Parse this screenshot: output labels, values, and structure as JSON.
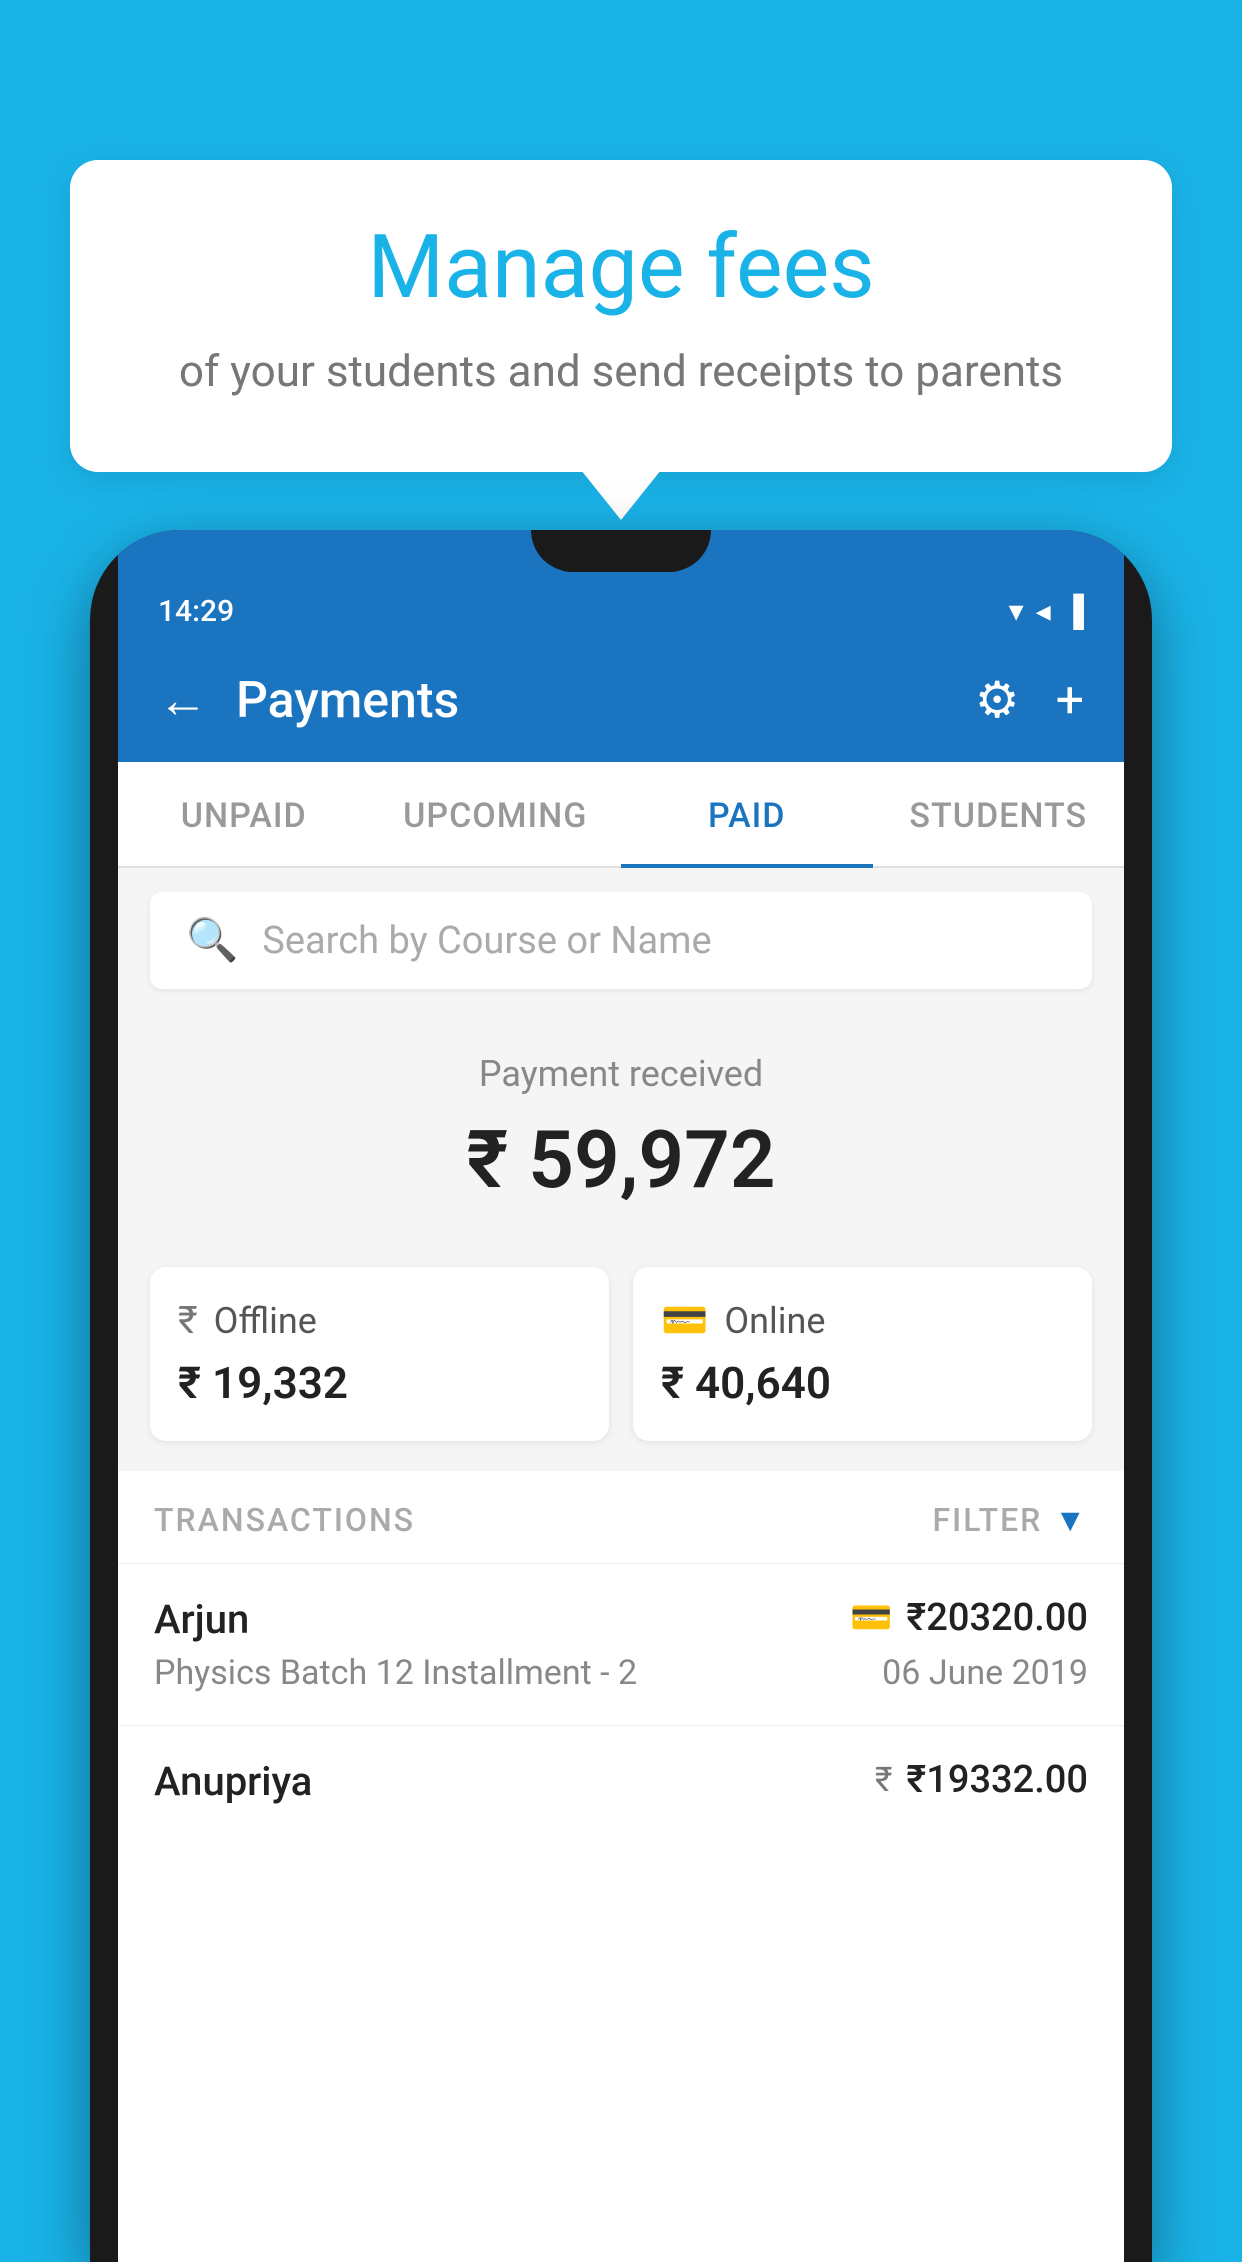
{
  "background_color": "#1ab3e8",
  "bubble": {
    "title": "Manage fees",
    "subtitle": "of your students and send receipts to parents"
  },
  "status_bar": {
    "time": "14:29",
    "icons": "▲ ◀ ▐"
  },
  "header": {
    "title": "Payments",
    "back_label": "←",
    "gear_label": "⚙",
    "plus_label": "+"
  },
  "tabs": [
    {
      "label": "UNPAID",
      "active": false
    },
    {
      "label": "UPCOMING",
      "active": false
    },
    {
      "label": "PAID",
      "active": true
    },
    {
      "label": "STUDENTS",
      "active": false
    }
  ],
  "search": {
    "placeholder": "Search by Course or Name"
  },
  "payment_section": {
    "label": "Payment received",
    "amount": "₹ 59,972",
    "offline_label": "Offline",
    "offline_amount": "₹ 19,332",
    "online_label": "Online",
    "online_amount": "₹ 40,640"
  },
  "transactions": {
    "header_label": "TRANSACTIONS",
    "filter_label": "FILTER",
    "rows": [
      {
        "name": "Arjun",
        "payment_icon": "card",
        "amount": "₹20320.00",
        "course": "Physics Batch 12 Installment - 2",
        "date": "06 June 2019"
      },
      {
        "name": "Anupriya",
        "payment_icon": "cash",
        "amount": "₹19332.00",
        "course": "",
        "date": ""
      }
    ]
  }
}
